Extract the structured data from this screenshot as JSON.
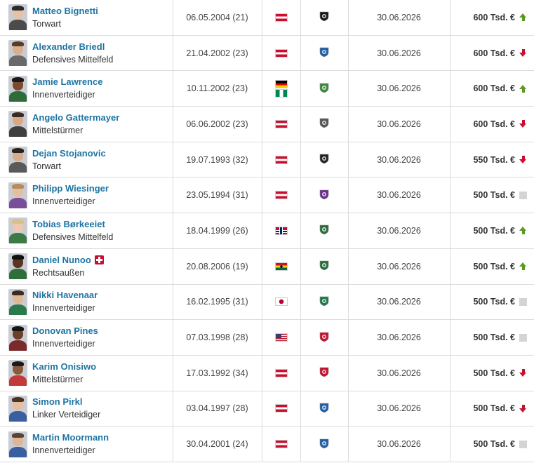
{
  "players": [
    {
      "name": "Matteo Bignetti",
      "position": "Torwart",
      "dob": "06.05.2004 (21)",
      "nationalities": [
        "at"
      ],
      "club_icon": "club-crest-sturm",
      "club_color": "#1a1a1a",
      "contract": "30.06.2026",
      "market_value": "600 Tsd. €",
      "trend": "up",
      "injury": false,
      "skin": "#e6c1a3",
      "hair": "#2b2b2b",
      "shirt": "#4b4b4b"
    },
    {
      "name": "Alexander Briedl",
      "position": "Defensives Mittelfeld",
      "dob": "21.04.2002 (23)",
      "nationalities": [
        "at"
      ],
      "club_icon": "club-crest-blue",
      "club_color": "#1f5fa8",
      "contract": "30.06.2026",
      "market_value": "600 Tsd. €",
      "trend": "down",
      "injury": false,
      "skin": "#d9b08e",
      "hair": "#5a3b24",
      "shirt": "#6a6a6a"
    },
    {
      "name": "Jamie Lawrence",
      "position": "Innenverteidiger",
      "dob": "10.11.2002 (23)",
      "nationalities": [
        "de",
        "ng"
      ],
      "club_icon": "club-crest-green-red",
      "club_color": "#3a8a3a",
      "contract": "30.06.2026",
      "market_value": "600 Tsd. €",
      "trend": "up",
      "injury": false,
      "skin": "#7a4b2e",
      "hair": "#1a1a1a",
      "shirt": "#2e6d3a"
    },
    {
      "name": "Angelo Gattermayer",
      "position": "Mittelstürmer",
      "dob": "06.06.2002 (23)",
      "nationalities": [
        "at"
      ],
      "club_icon": "club-crest-dark",
      "club_color": "#555555",
      "contract": "30.06.2026",
      "market_value": "600 Tsd. €",
      "trend": "down",
      "injury": false,
      "skin": "#d8a886",
      "hair": "#3a2a20",
      "shirt": "#3f3f3f"
    },
    {
      "name": "Dejan Stojanovic",
      "position": "Torwart",
      "dob": "19.07.1993 (32)",
      "nationalities": [
        "at"
      ],
      "club_icon": "club-crest-black-white",
      "club_color": "#222222",
      "contract": "30.06.2026",
      "market_value": "550 Tsd. €",
      "trend": "down",
      "injury": false,
      "skin": "#d7ab8c",
      "hair": "#2a221c",
      "shirt": "#5a5a5a"
    },
    {
      "name": "Philipp Wiesinger",
      "position": "Innenverteidiger",
      "dob": "23.05.1994 (31)",
      "nationalities": [
        "at"
      ],
      "club_icon": "club-crest-violet",
      "club_color": "#6b2d8f",
      "contract": "30.06.2026",
      "market_value": "500 Tsd. €",
      "trend": "same",
      "injury": false,
      "skin": "#e3bea0",
      "hair": "#b78b5a",
      "shirt": "#7a4f9a"
    },
    {
      "name": "Tobias Børkeeiet",
      "position": "Defensives Mittelfeld",
      "dob": "18.04.1999 (26)",
      "nationalities": [
        "no"
      ],
      "club_icon": "club-crest-rapid",
      "club_color": "#2a6f3a",
      "contract": "30.06.2026",
      "market_value": "500 Tsd. €",
      "trend": "up",
      "injury": false,
      "skin": "#ecc9ad",
      "hair": "#d8c08a",
      "shirt": "#3b7a44"
    },
    {
      "name": "Daniel Nunoo",
      "position": "Rechtsaußen",
      "dob": "20.08.2006 (19)",
      "nationalities": [
        "gh"
      ],
      "club_icon": "club-crest-rapid",
      "club_color": "#2a6f3a",
      "contract": "30.06.2026",
      "market_value": "500 Tsd. €",
      "trend": "up",
      "injury": true,
      "skin": "#5a3522",
      "hair": "#111111",
      "shirt": "#2f6d3a"
    },
    {
      "name": "Nikki Havenaar",
      "position": "Innenverteidiger",
      "dob": "16.02.1995 (31)",
      "nationalities": [
        "jp"
      ],
      "club_icon": "club-crest-green-white",
      "club_color": "#1f7a4a",
      "contract": "30.06.2026",
      "market_value": "500 Tsd. €",
      "trend": "same",
      "injury": false,
      "skin": "#e0b894",
      "hair": "#3a2b22",
      "shirt": "#2a7a4c"
    },
    {
      "name": "Donovan Pines",
      "position": "Innenverteidiger",
      "dob": "07.03.1998 (28)",
      "nationalities": [
        "us"
      ],
      "club_icon": "club-crest-red",
      "club_color": "#c8102e",
      "contract": "30.06.2026",
      "market_value": "500 Tsd. €",
      "trend": "same",
      "injury": false,
      "skin": "#6b3f28",
      "hair": "#141414",
      "shirt": "#7a2a2a"
    },
    {
      "name": "Karim Onisiwo",
      "position": "Mittelstürmer",
      "dob": "17.03.1992 (34)",
      "nationalities": [
        "at"
      ],
      "club_icon": "club-crest-salzburg",
      "club_color": "#c8102e",
      "contract": "30.06.2026",
      "market_value": "500 Tsd. €",
      "trend": "down",
      "injury": false,
      "skin": "#8a5a3a",
      "hair": "#1a1a1a",
      "shirt": "#c23a3a"
    },
    {
      "name": "Simon Pirkl",
      "position": "Linker Verteidiger",
      "dob": "03.04.1997 (28)",
      "nationalities": [
        "at"
      ],
      "club_icon": "club-crest-blue",
      "club_color": "#1f5fa8",
      "contract": "30.06.2026",
      "market_value": "500 Tsd. €",
      "trend": "down",
      "injury": false,
      "skin": "#e4bfa0",
      "hair": "#4a3424",
      "shirt": "#3a5fa0"
    },
    {
      "name": "Martin Moormann",
      "position": "Innenverteidiger",
      "dob": "30.04.2001 (24)",
      "nationalities": [
        "at"
      ],
      "club_icon": "club-crest-blue",
      "club_color": "#1f5fa8",
      "contract": "30.06.2026",
      "market_value": "500 Tsd. €",
      "trend": "same",
      "injury": false,
      "skin": "#dfb596",
      "hair": "#5b4332",
      "shirt": "#3a5fa0"
    }
  ]
}
